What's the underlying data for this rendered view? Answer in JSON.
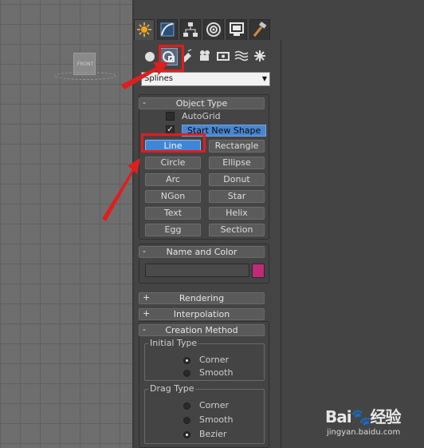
{
  "viewport": {
    "cube_label": "FRONT"
  },
  "command_panel": {
    "tabs": [
      "create-tab",
      "modify-tab",
      "hierarchy-tab",
      "motion-tab",
      "display-tab",
      "utilities-tab"
    ],
    "sub_icons": [
      "geometry-icon",
      "shapes-icon",
      "lights-icon",
      "cameras-icon",
      "helpers-icon",
      "space-warps-icon",
      "systems-icon"
    ],
    "category_dropdown": {
      "value": "Splines"
    }
  },
  "object_type": {
    "title": "Object Type",
    "collapse_sign": "-",
    "autogrid": {
      "label": "AutoGrid",
      "checked": false
    },
    "start_new_shape": {
      "label": "Start New Shape",
      "checked": true
    },
    "buttons": [
      "Line",
      "Rectangle",
      "Circle",
      "Ellipse",
      "Arc",
      "Donut",
      "NGon",
      "Star",
      "Text",
      "Helix",
      "Egg",
      "Section"
    ],
    "selected": "Line"
  },
  "name_and_color": {
    "title": "Name and Color",
    "collapse_sign": "-",
    "name_value": "",
    "color": "#c02b79"
  },
  "rendering": {
    "title": "Rendering",
    "collapse_sign": "+"
  },
  "interpolation": {
    "title": "Interpolation",
    "collapse_sign": "+"
  },
  "creation_method": {
    "title": "Creation Method",
    "collapse_sign": "-",
    "initial_type": {
      "title": "Initial Type",
      "options": [
        "Corner",
        "Smooth"
      ],
      "selected": "Corner"
    },
    "drag_type": {
      "title": "Drag Type",
      "options": [
        "Corner",
        "Smooth",
        "Bezier"
      ],
      "selected": "Bezier"
    }
  },
  "annotation_color": "#e01e1e",
  "watermark": {
    "brand": "Bai",
    "brand_suffix": "经验",
    "url": "jingyan.baidu.com"
  }
}
